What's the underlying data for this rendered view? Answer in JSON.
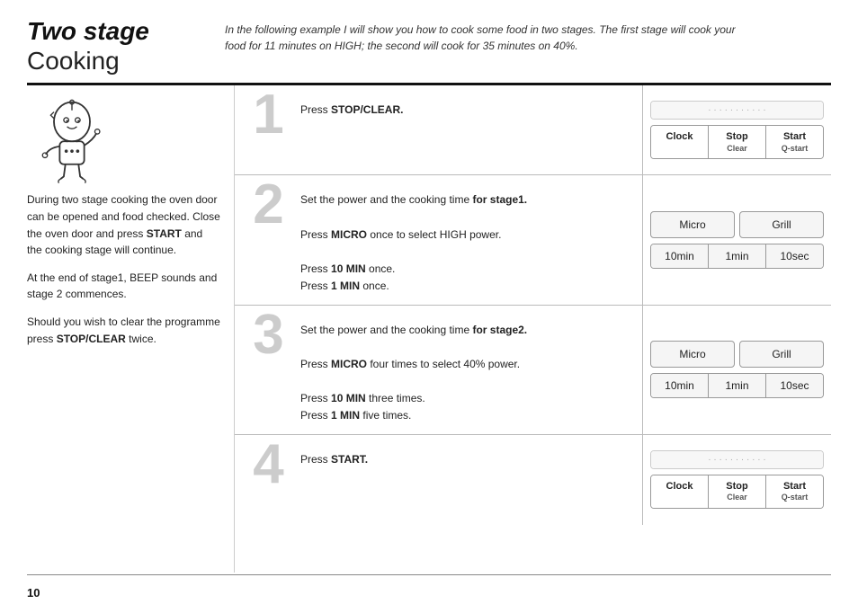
{
  "header": {
    "title_italic": "Two stage",
    "title_normal": "Cooking",
    "description": "In the following example I will show you how to cook some food in two stages. The first stage will cook your food for 11 minutes on HIGH; the second will cook for 35 minutes on 40%."
  },
  "left": {
    "para1": "During two stage cooking the oven door can be opened and food checked. Close the oven door and press START and the cooking stage will continue.",
    "para1_bold": "START",
    "para2": "At the end of stage1, BEEP sounds and stage 2 commences.",
    "para3_prefix": "Should you wish to clear the programme press ",
    "para3_bold": "STOP/CLEAR",
    "para3_suffix": " twice."
  },
  "steps": [
    {
      "number": "1",
      "lines": [
        {
          "text": "Press ",
          "bold": "STOP/CLEAR",
          "suffix": "."
        }
      ],
      "buttons": {
        "type": "stop_start",
        "items": [
          "Clock",
          "Stop\nClear",
          "Start\nQ-start"
        ]
      }
    },
    {
      "number": "2",
      "lines": [
        {
          "text": "Set the power and the cooking time ",
          "bold": "for stage1.",
          "suffix": ""
        },
        {
          "text": ""
        },
        {
          "text": "Press ",
          "bold": "MICRO",
          "suffix": " once to select HIGH power."
        },
        {
          "text": ""
        },
        {
          "text": "Press ",
          "bold": "10 MIN",
          "suffix": " once."
        },
        {
          "text": "Press ",
          "bold": "1 MIN",
          "suffix": " once."
        }
      ],
      "buttons": {
        "type": "micro_grill_time",
        "micro": "Micro",
        "grill": "Grill",
        "time": [
          "10min",
          "1min",
          "10sec"
        ]
      }
    },
    {
      "number": "3",
      "lines": [
        {
          "text": "Set the power and the cooking time ",
          "bold": "for stage2.",
          "suffix": ""
        },
        {
          "text": ""
        },
        {
          "text": "Press ",
          "bold": "MICRO",
          "suffix": " four times to select 40% power."
        },
        {
          "text": ""
        },
        {
          "text": "Press ",
          "bold": "10 MIN",
          "suffix": " three times."
        },
        {
          "text": "Press ",
          "bold": "1 MIN",
          "suffix": " five times."
        }
      ],
      "buttons": {
        "type": "micro_grill_time",
        "micro": "Micro",
        "grill": "Grill",
        "time": [
          "10min",
          "1min",
          "10sec"
        ]
      }
    },
    {
      "number": "4",
      "lines": [
        {
          "text": "Press ",
          "bold": "START",
          "suffix": "."
        }
      ],
      "buttons": {
        "type": "stop_start",
        "items": [
          "Clock",
          "Stop\nClear",
          "Start\nQ-start"
        ]
      }
    }
  ],
  "page_number": "10",
  "icons": {
    "clock": "Clock",
    "stop_clear": "Stop\nClear",
    "start_qstart": "Start\nQ-start"
  }
}
